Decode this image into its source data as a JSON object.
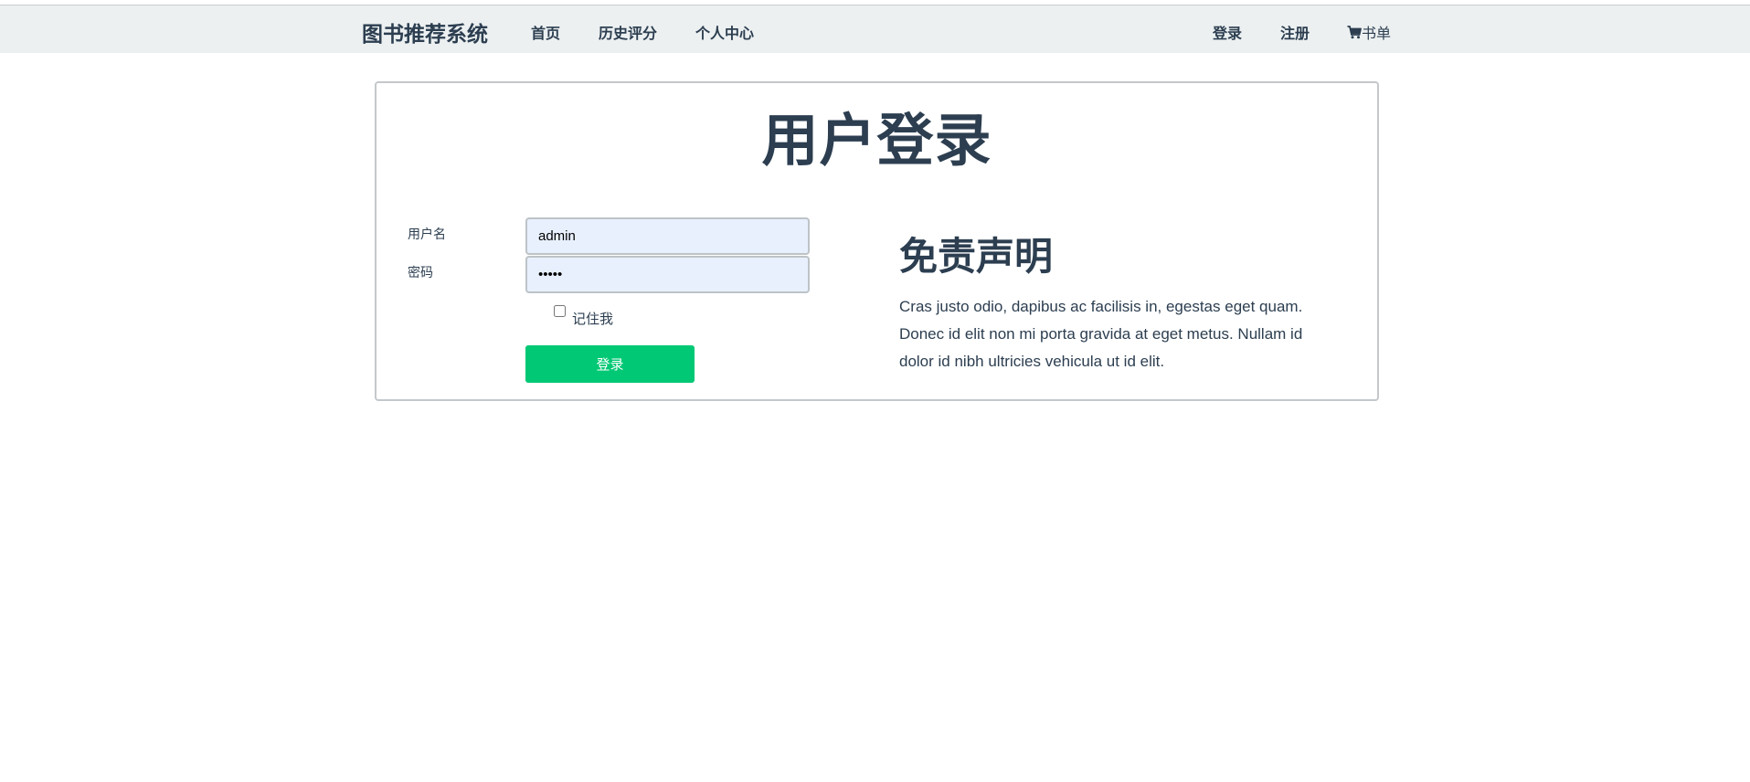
{
  "navbar": {
    "brand": "图书推荐系统",
    "links": [
      {
        "label": "首页"
      },
      {
        "label": "历史评分"
      },
      {
        "label": "个人中心"
      }
    ],
    "right_links": [
      {
        "label": "登录"
      },
      {
        "label": "注册"
      }
    ],
    "cart": {
      "icon": "cart-icon",
      "label": "书单"
    }
  },
  "login": {
    "title": "用户登录",
    "username_label": "用户名",
    "username_value": "admin",
    "password_label": "密码",
    "password_value": "admin",
    "remember_label": "记住我",
    "remember_checked": false,
    "submit_label": "登录"
  },
  "disclaimer": {
    "title": "免责声明",
    "text": "Cras justo odio, dapibus ac facilisis in, egestas eget quam. Donec id elit non mi porta gravida at eget metus. Nullam id dolor id nibh ultricies vehicula ut id elit."
  },
  "colors": {
    "navbar_bg": "#ecf0f1",
    "text": "#2c3e50",
    "button": "#00c874",
    "input_bg": "#e8f0fe"
  }
}
